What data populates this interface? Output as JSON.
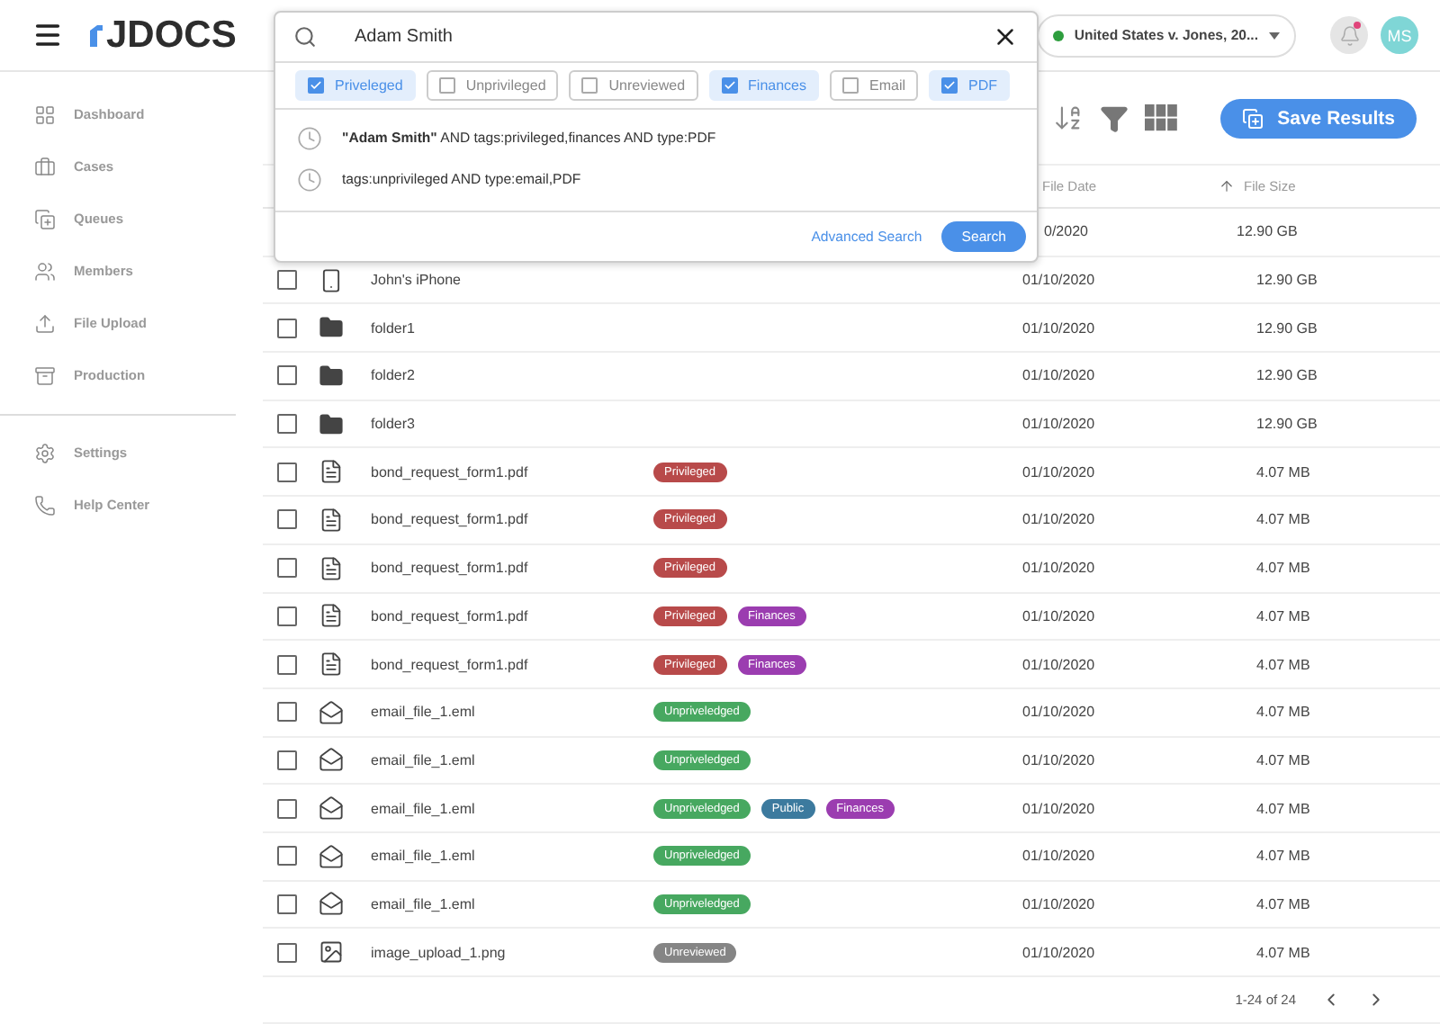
{
  "app": {
    "logo": "JDOCS"
  },
  "case_selector": {
    "label": "United States v. Jones, 20...",
    "color": "#2e9e3e"
  },
  "notifications": {
    "unread": true
  },
  "avatar": {
    "initials": "MS"
  },
  "sidebar": {
    "items": [
      {
        "label": "Dashboard",
        "kind": "dashboard"
      },
      {
        "label": "Cases",
        "kind": "cases"
      },
      {
        "label": "Queues",
        "kind": "queues"
      },
      {
        "label": "Members",
        "kind": "members"
      },
      {
        "label": "File Upload",
        "kind": "upload"
      },
      {
        "label": "Production",
        "kind": "production"
      }
    ],
    "bottom_items": [
      {
        "label": "Settings",
        "kind": "settings"
      },
      {
        "label": "Help Center",
        "kind": "help"
      }
    ]
  },
  "search": {
    "value": "Adam Smith",
    "filters": [
      {
        "label": "Priveleged",
        "selected": true
      },
      {
        "label": "Unprivileged",
        "selected": false
      },
      {
        "label": "Unreviewed",
        "selected": false
      },
      {
        "label": "Finances",
        "selected": true
      },
      {
        "label": "Email",
        "selected": false
      },
      {
        "label": "PDF",
        "selected": true
      }
    ],
    "history": [
      "**\"Adam Smith\"** AND tags:privileged,finances AND type:PDF",
      "tags:unprivileged AND type:email,PDF"
    ],
    "advanced_link": "Advanced Search",
    "search_button": "Search"
  },
  "toolbar": {
    "save_button": "Save Results"
  },
  "table": {
    "columns": [
      {
        "label": "File Date",
        "sorted": false
      },
      {
        "label": "File Size",
        "sorted": true
      }
    ],
    "rows": [
      {
        "kind": "hidden",
        "date": "0/2020",
        "size": "12.90 GB",
        "tags": []
      },
      {
        "kind": "device",
        "checked": false,
        "name": "John's iPhone",
        "date": "01/10/2020",
        "size": "12.90 GB",
        "tags": []
      },
      {
        "kind": "folder",
        "checked": false,
        "name": "folder1",
        "date": "01/10/2020",
        "size": "12.90 GB",
        "tags": []
      },
      {
        "kind": "folder",
        "checked": false,
        "name": "folder2",
        "date": "01/10/2020",
        "size": "12.90 GB",
        "tags": []
      },
      {
        "kind": "folder",
        "checked": false,
        "name": "folder3",
        "date": "01/10/2020",
        "size": "12.90 GB",
        "tags": []
      },
      {
        "kind": "pdf",
        "checked": false,
        "name": "bond_request_form1.pdf",
        "date": "01/10/2020",
        "size": "4.07 MB",
        "tags": [
          {
            "label": "Privileged",
            "color": "#b84a4a"
          }
        ]
      },
      {
        "kind": "pdf",
        "checked": false,
        "name": "bond_request_form1.pdf",
        "date": "01/10/2020",
        "size": "4.07 MB",
        "tags": [
          {
            "label": "Privileged",
            "color": "#b84a4a"
          }
        ]
      },
      {
        "kind": "pdf",
        "checked": false,
        "name": "bond_request_form1.pdf",
        "date": "01/10/2020",
        "size": "4.07 MB",
        "tags": [
          {
            "label": "Privileged",
            "color": "#b84a4a"
          }
        ]
      },
      {
        "kind": "pdf",
        "checked": false,
        "name": "bond_request_form1.pdf",
        "date": "01/10/2020",
        "size": "4.07 MB",
        "tags": [
          {
            "label": "Privileged",
            "color": "#b84a4a"
          },
          {
            "label": "Finances",
            "color": "#9b3db0"
          }
        ]
      },
      {
        "kind": "pdf",
        "checked": false,
        "name": "bond_request_form1.pdf",
        "date": "01/10/2020",
        "size": "4.07 MB",
        "tags": [
          {
            "label": "Privileged",
            "color": "#b84a4a"
          },
          {
            "label": "Finances",
            "color": "#9b3db0"
          }
        ]
      },
      {
        "kind": "email",
        "checked": false,
        "name": "email_file_1.eml",
        "date": "01/10/2020",
        "size": "4.07 MB",
        "tags": [
          {
            "label": "Unpriveledged",
            "color": "#47a860"
          }
        ]
      },
      {
        "kind": "email",
        "checked": false,
        "name": "email_file_1.eml",
        "date": "01/10/2020",
        "size": "4.07 MB",
        "tags": [
          {
            "label": "Unpriveledged",
            "color": "#47a860"
          }
        ]
      },
      {
        "kind": "email",
        "checked": false,
        "name": "email_file_1.eml",
        "date": "01/10/2020",
        "size": "4.07 MB",
        "tags": [
          {
            "label": "Unpriveledged",
            "color": "#47a860"
          },
          {
            "label": "Public",
            "color": "#3c7a9e"
          },
          {
            "label": "Finances",
            "color": "#9b3db0"
          }
        ]
      },
      {
        "kind": "email",
        "checked": false,
        "name": "email_file_1.eml",
        "date": "01/10/2020",
        "size": "4.07 MB",
        "tags": [
          {
            "label": "Unpriveledged",
            "color": "#47a860"
          }
        ]
      },
      {
        "kind": "email",
        "checked": false,
        "name": "email_file_1.eml",
        "date": "01/10/2020",
        "size": "4.07 MB",
        "tags": [
          {
            "label": "Unpriveledged",
            "color": "#47a860"
          }
        ]
      },
      {
        "kind": "image",
        "checked": false,
        "name": "image_upload_1.png",
        "date": "01/10/2020",
        "size": "4.07 MB",
        "tags": [
          {
            "label": "Unreviewed",
            "color": "#858585"
          }
        ]
      }
    ]
  },
  "pagination": {
    "label": "1-24 of 24"
  }
}
